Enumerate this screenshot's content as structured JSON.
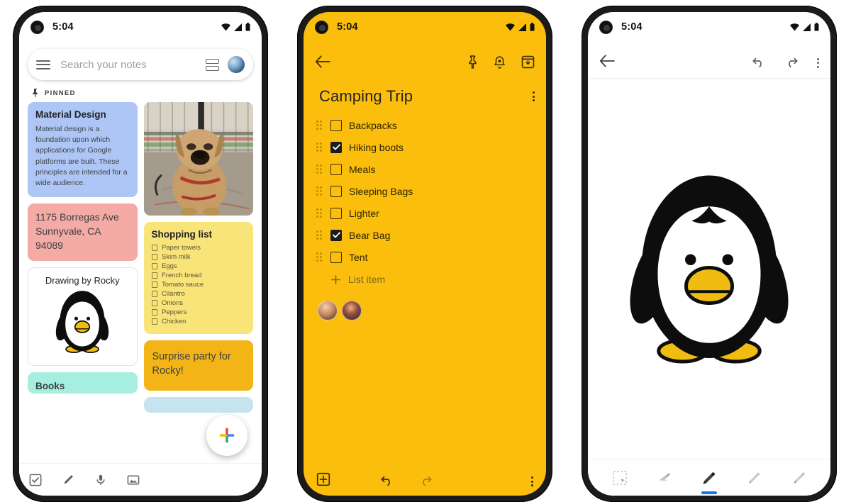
{
  "statusbar": {
    "time": "5:04",
    "wifi_icon": "wifi-icon",
    "signal_icon": "signal-icon",
    "battery_icon": "battery-icon"
  },
  "phone1": {
    "search": {
      "placeholder": "Search your notes",
      "menu_icon": "hamburger-menu-icon",
      "view_toggle_icon": "list-view-toggle-icon",
      "avatar_icon": "profile-avatar-icon"
    },
    "section": {
      "pin_icon": "pin-icon",
      "label": "PINNED"
    },
    "notes": [
      {
        "id": "material-design",
        "color": "#aec6f5",
        "title": "Material Design",
        "body": "Material design is a foundation upon which applications for Google platforms are built. These principles are intended for a wide audience."
      },
      {
        "id": "dog-photo",
        "color": "#b7a894",
        "kind": "photo",
        "alt": "dog-photo"
      },
      {
        "id": "address",
        "color": "#f4aaa5",
        "body": "1175 Borregas Ave Sunnyvale, CA 94089"
      },
      {
        "id": "shopping-list",
        "color": "#f8e479",
        "title": "Shopping list",
        "items": [
          "Paper towels",
          "Skim milk",
          "Eggs",
          "French bread",
          "Tomato sauce",
          "Cilantro",
          "Onions",
          "Peppers",
          "Chicken"
        ]
      },
      {
        "id": "drawing-by-rocky",
        "color": "#ffffff",
        "title": "Drawing by Rocky",
        "kind": "drawing"
      },
      {
        "id": "surprise-party",
        "color": "#f2b416",
        "body": "Surprise party for Rocky!"
      },
      {
        "id": "books",
        "color": "#a6eedf",
        "title": "Books"
      },
      {
        "id": "partial-blue",
        "color": "#c6e4ef",
        "title": ""
      }
    ],
    "bottom_bar": [
      {
        "name": "new-list-icon",
        "label": "New list"
      },
      {
        "name": "new-drawing-icon",
        "label": "New drawing"
      },
      {
        "name": "new-voice-note-icon",
        "label": "New recording"
      },
      {
        "name": "new-image-note-icon",
        "label": "New image note"
      }
    ],
    "fab": {
      "name": "create-note-fab",
      "label": "Create note",
      "colors": [
        "#4285f4",
        "#ea4335",
        "#fbbc05",
        "#34a853"
      ]
    }
  },
  "phone2": {
    "background": "#fcbe0d",
    "appbar": {
      "back_icon": "back-arrow-icon",
      "actions": [
        {
          "name": "pin-icon",
          "label": "Pin note"
        },
        {
          "name": "reminder-bell-icon",
          "label": "Remind me"
        },
        {
          "name": "archive-icon",
          "label": "Archive"
        }
      ]
    },
    "title": "Camping Trip",
    "overflow_icon": "more-options-icon",
    "tasks": [
      {
        "label": "Backpacks",
        "checked": false
      },
      {
        "label": "Hiking boots",
        "checked": true
      },
      {
        "label": "Meals",
        "checked": false
      },
      {
        "label": "Sleeping Bags",
        "checked": false
      },
      {
        "label": "Lighter",
        "checked": false
      },
      {
        "label": "Bear Bag",
        "checked": true
      },
      {
        "label": "Tent",
        "checked": false
      }
    ],
    "add_item": {
      "icon": "plus-icon",
      "label": "List item"
    },
    "collaborators": [
      {
        "name": "collaborator-avatar-1"
      },
      {
        "name": "collaborator-avatar-2"
      }
    ],
    "bottom_bar": {
      "add_icon": "add-box-icon",
      "undo_icon": "undo-icon",
      "redo_icon": "redo-icon",
      "overflow_icon": "more-options-icon"
    }
  },
  "phone3": {
    "appbar": {
      "back_icon": "back-arrow-icon",
      "undo_icon": "undo-icon",
      "redo_icon": "redo-icon",
      "overflow_icon": "more-options-icon"
    },
    "canvas": {
      "drawing": "penguin-drawing"
    },
    "tools": [
      {
        "name": "selection-tool-icon",
        "label": "Select",
        "active": false
      },
      {
        "name": "eraser-tool-icon",
        "label": "Eraser",
        "active": false
      },
      {
        "name": "marker-tool-icon",
        "label": "Marker",
        "active": true
      },
      {
        "name": "pen-tool-icon",
        "label": "Pen",
        "active": false
      },
      {
        "name": "highlighter-tool-icon",
        "label": "Highlighter",
        "active": false
      }
    ],
    "active_indicator_color": "#1a73e8"
  }
}
